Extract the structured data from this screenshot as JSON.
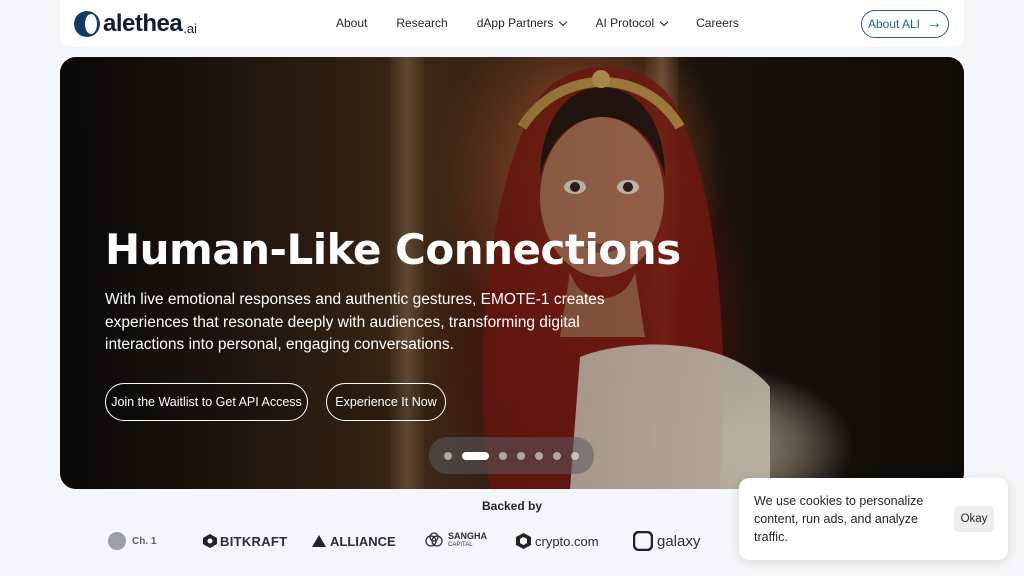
{
  "nav": {
    "logo_text": "alethea",
    "logo_suffix": ".ai",
    "items": [
      {
        "label": "About",
        "dropdown": false
      },
      {
        "label": "Research",
        "dropdown": false
      },
      {
        "label": "dApp Partners",
        "dropdown": true
      },
      {
        "label": "AI Protocol",
        "dropdown": true
      },
      {
        "label": "Careers",
        "dropdown": false
      }
    ],
    "cta_label": "About ALI",
    "cta_icon": "arrow-right-icon"
  },
  "hero": {
    "title": "Human-Like Connections",
    "description": "With live emotional responses and authentic gestures, EMOTE-1 creates experiences that resonate deeply with audiences, transforming digital interactions into personal, engaging conversations.",
    "primary_button": "Join the Waitlist to Get API Access",
    "secondary_button": "Experience It Now",
    "carousel": {
      "total_slides": 7,
      "active_index": 1
    }
  },
  "backers": {
    "title": "Backed by",
    "logos": [
      "Ch. 1",
      "BITKRAFT",
      "ALLIANCE",
      "SANGHA",
      "CAPITAL",
      "crypto.com",
      "galaxy"
    ]
  },
  "cookie": {
    "text": "We use cookies to personalize content, run ads, and analyze traffic.",
    "button": "Okay"
  },
  "colors": {
    "accent": "#1d5fae",
    "logo": "#123a66",
    "page_bg": "#f3f6fa"
  }
}
